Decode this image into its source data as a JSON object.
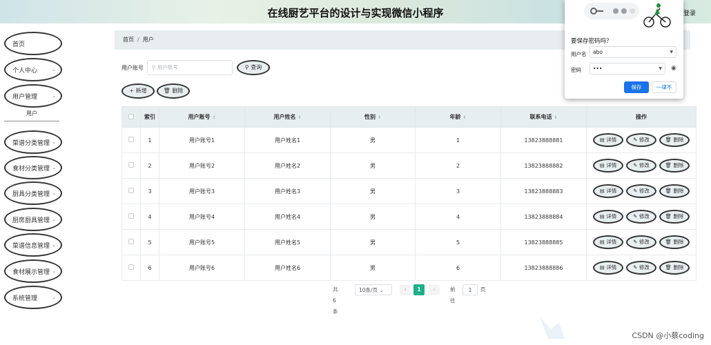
{
  "header": {
    "title": "在线厨艺平台的设计与实现微信小程序",
    "login": "登录"
  },
  "sidebar": {
    "items": [
      {
        "label": "首页",
        "chevron": ""
      },
      {
        "label": "个人中心",
        "chevron": "⌄"
      },
      {
        "label": "用户管理",
        "chevron": "⌄"
      },
      {
        "label": "菜谱分类管理",
        "chevron": "⌄"
      },
      {
        "label": "食材分类管理",
        "chevron": "⌄"
      },
      {
        "label": "厨具分类管理",
        "chevron": "⌄"
      },
      {
        "label": "厨房厨具管理",
        "chevron": "⌄"
      },
      {
        "label": "菜谱信息管理",
        "chevron": "⌄"
      },
      {
        "label": "食材展示管理",
        "chevron": "⌄"
      },
      {
        "label": "系统管理",
        "chevron": "⌄"
      }
    ],
    "sub_item": "用户"
  },
  "breadcrumb": {
    "home": "首页",
    "separator": "/",
    "current": "用户"
  },
  "search": {
    "label": "用户账号",
    "placeholder": "用户账号",
    "button": "查询",
    "search_icon": "search-icon"
  },
  "toolbar": {
    "add": "新增",
    "delete": "删除"
  },
  "table": {
    "columns": [
      "索引",
      "用户账号",
      "用户姓名",
      "性别",
      "年龄",
      "联系电话",
      "操作"
    ],
    "rows": [
      {
        "index": "1",
        "account": "用户账号1",
        "name": "用户姓名1",
        "gender": "男",
        "age": "1",
        "phone": "13823888881"
      },
      {
        "index": "2",
        "account": "用户账号2",
        "name": "用户姓名2",
        "gender": "男",
        "age": "2",
        "phone": "13823888882"
      },
      {
        "index": "3",
        "account": "用户账号3",
        "name": "用户姓名3",
        "gender": "男",
        "age": "3",
        "phone": "13823888883"
      },
      {
        "index": "4",
        "account": "用户账号4",
        "name": "用户姓名4",
        "gender": "男",
        "age": "4",
        "phone": "13823888884"
      },
      {
        "index": "5",
        "account": "用户账号5",
        "name": "用户姓名5",
        "gender": "男",
        "age": "5",
        "phone": "13823888885"
      },
      {
        "index": "6",
        "account": "用户账号6",
        "name": "用户姓名6",
        "gender": "男",
        "age": "6",
        "phone": "13823888886"
      }
    ],
    "actions": {
      "detail": "详情",
      "edit": "修改",
      "delete": "删除"
    }
  },
  "pagination": {
    "total": "共 6 条",
    "page_size": "10条/页",
    "prev": "‹",
    "current": "1",
    "next": "›",
    "goto_label": "前往",
    "goto_value": "1",
    "page_unit": "页"
  },
  "password_popup": {
    "question": "要保存密码吗？",
    "username_label": "用户名",
    "username_value": "abo",
    "password_label": "密码",
    "password_value": "•••",
    "save": "保存",
    "never": "一律不"
  },
  "watermark": "CSDN @小蔡coding",
  "colors": {
    "accent": "#1bb08a",
    "save_button": "#1a73e8",
    "header_bg": "#d7ebe0",
    "table_header": "#e7eef0"
  }
}
